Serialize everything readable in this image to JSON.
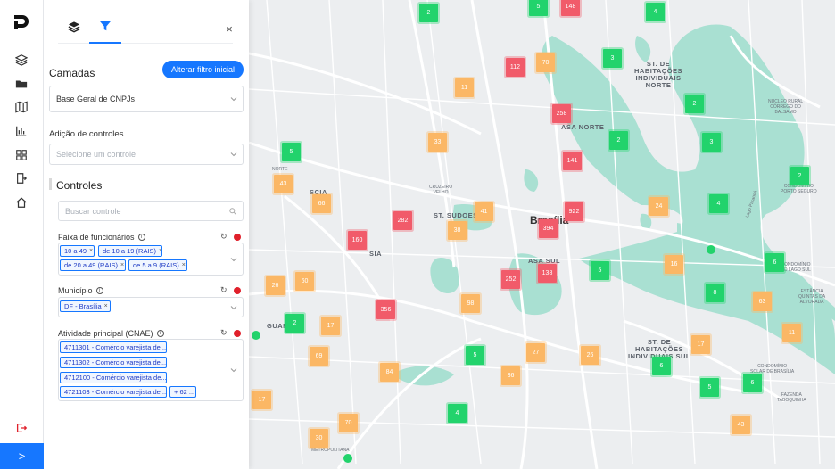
{
  "rail": {
    "items": [
      {
        "name": "layers-icon"
      },
      {
        "name": "folder-icon"
      },
      {
        "name": "map-icon"
      },
      {
        "name": "bar-chart-icon"
      },
      {
        "name": "grid-icon"
      },
      {
        "name": "export-icon"
      },
      {
        "name": "home-icon"
      }
    ],
    "expand_glyph": ">"
  },
  "panel": {
    "close_glyph": "×",
    "layers_title": "Camadas",
    "reset_button": "Alterar filtro inicial",
    "layer_select": "Base Geral de CNPJs",
    "controls_add_label": "Adição de controles",
    "controls_add_placeholder": "Selecione um controle",
    "controls_title": "Controles",
    "search_placeholder": "Buscar controle",
    "controls": [
      {
        "title": "Faixa de funcionários",
        "tags": [
          "10 a 49",
          "de 10 a 19 (RAIS)",
          "de 20 a 49 (RAIS)",
          "de 5 a 9 (RAIS)"
        ]
      },
      {
        "title": "Município",
        "tags": [
          "DF - Brasília"
        ]
      },
      {
        "title": "Atividade principal (CNAE)",
        "tags": [
          "4711301 - Comércio varejista de ...",
          "4711302 - Comércio varejista de...",
          "4712100 - Comércio varejista de...",
          "4721103 - Comércio varejista de ...",
          "+ 62 ..."
        ]
      }
    ]
  },
  "map": {
    "clusters": [
      {
        "v": "2",
        "c": "green"
      },
      {
        "v": "5",
        "c": "green"
      },
      {
        "v": "148",
        "c": "red"
      },
      {
        "v": "4",
        "c": "green"
      },
      {
        "v": "112",
        "c": "red"
      },
      {
        "v": "70",
        "c": "orange"
      },
      {
        "v": "3",
        "c": "green"
      },
      {
        "v": "11",
        "c": "orange"
      },
      {
        "v": "258",
        "c": "red"
      },
      {
        "v": "2",
        "c": "green"
      },
      {
        "v": "33",
        "c": "orange"
      },
      {
        "v": "2",
        "c": "green"
      },
      {
        "v": "3",
        "c": "green"
      },
      {
        "v": "141",
        "c": "red"
      },
      {
        "v": "5",
        "c": "green"
      },
      {
        "v": "43",
        "c": "orange"
      },
      {
        "v": "2",
        "c": "green"
      },
      {
        "v": "66",
        "c": "orange"
      },
      {
        "v": "4",
        "c": "green"
      },
      {
        "v": "282",
        "c": "red"
      },
      {
        "v": "41",
        "c": "orange"
      },
      {
        "v": "922",
        "c": "red"
      },
      {
        "v": "24",
        "c": "orange"
      },
      {
        "v": "394",
        "c": "red"
      },
      {
        "v": "38",
        "c": "orange"
      },
      {
        "v": "160",
        "c": "red"
      },
      {
        "v": "6",
        "c": "green"
      },
      {
        "v": "5",
        "c": "green"
      },
      {
        "v": "16",
        "c": "orange"
      },
      {
        "v": "138",
        "c": "red"
      },
      {
        "v": "252",
        "c": "red"
      },
      {
        "v": "26",
        "c": "orange"
      },
      {
        "v": "60",
        "c": "orange"
      },
      {
        "v": "8",
        "c": "green"
      },
      {
        "v": "98",
        "c": "orange"
      },
      {
        "v": "63",
        "c": "orange"
      },
      {
        "v": "356",
        "c": "red"
      },
      {
        "v": "2",
        "c": "green"
      },
      {
        "v": "17",
        "c": "orange"
      },
      {
        "v": "11",
        "c": "orange"
      },
      {
        "v": "17",
        "c": "orange"
      },
      {
        "v": "69",
        "c": "orange"
      },
      {
        "v": "27",
        "c": "orange"
      },
      {
        "v": "5",
        "c": "green"
      },
      {
        "v": "26",
        "c": "orange"
      },
      {
        "v": "6",
        "c": "green"
      },
      {
        "v": "84",
        "c": "orange"
      },
      {
        "v": "36",
        "c": "orange"
      },
      {
        "v": "6",
        "c": "green"
      },
      {
        "v": "5",
        "c": "green"
      },
      {
        "v": "17",
        "c": "orange"
      },
      {
        "v": "4",
        "c": "green"
      },
      {
        "v": "70",
        "c": "orange"
      },
      {
        "v": "43",
        "c": "orange"
      },
      {
        "v": "30",
        "c": "orange"
      }
    ],
    "labels": {
      "habitacoes_norte": "ST. DE\nHABITAÇÕES\nINDIVIDUAIS\nNORTE",
      "asa_norte": "ASA NORTE",
      "norte": "NORTE",
      "st_sudoeste": "ST. SUDOES",
      "brasilia": "Brasília",
      "asa_sul": "ASA SUL",
      "habitacoes_sul": "ST. DE\nHABITAÇÕES\nINDIVIDUAIS SUL",
      "sia": "SIA",
      "scia": "SCIA",
      "guara": "GUARÁ",
      "nucleo_rural": "NÚCLEO RURAL\nCÓRREGO DO\nBALSAMO",
      "condominio_porto": "CONDOMÍNIO\nPORTO SEGURO",
      "condominio_lago": "CONDOMÍNIO\nDO LAGO SUL",
      "estancia": "ESTÂNCIA\nQUINTAS DA\nALVORADA",
      "condominio_brasilia": "CONDOMÍNIO\nSOLAR DE BRASÍLIA",
      "fazenda": "FAZENDA\nTABOQUINHA",
      "metropolitana": "METROPOLITANA",
      "cruzeiro": "CRUZEIRO\nVELHO",
      "lago_paranoa": "Lago Paranoá"
    }
  }
}
